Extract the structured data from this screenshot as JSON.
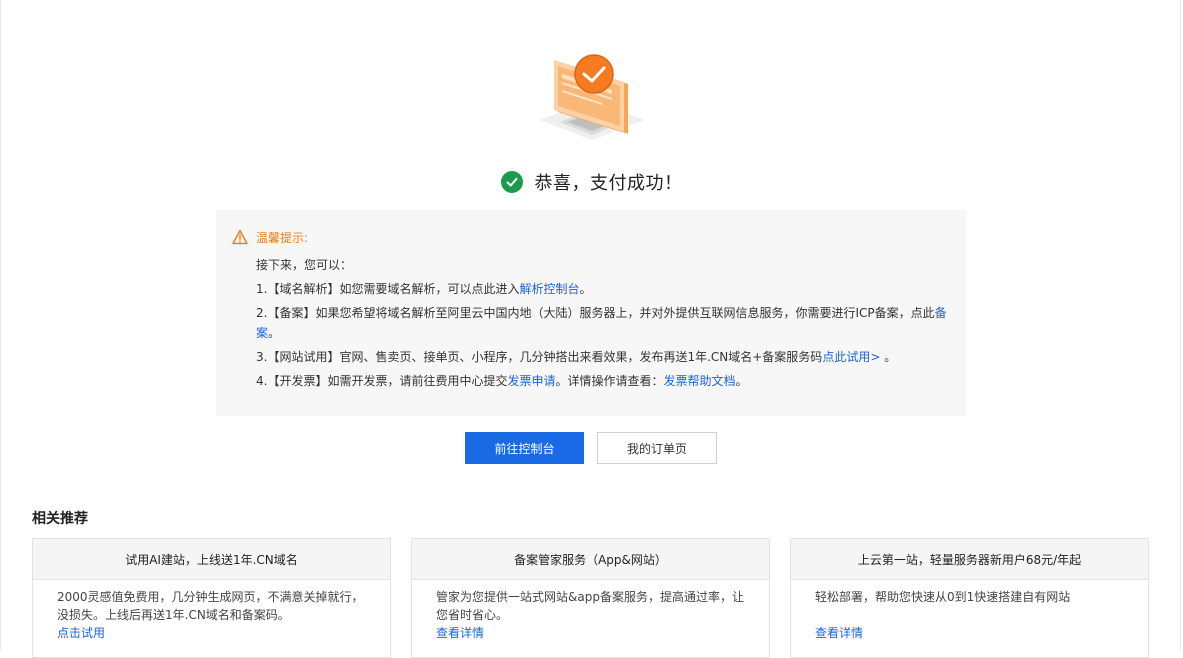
{
  "success": {
    "title": "恭喜，支付成功！"
  },
  "tips": {
    "heading": "温馨提示:",
    "intro": "接下来，您可以：",
    "item1": {
      "text": "1.【域名解析】如您需要域名解析，可以点此进入",
      "link": "解析控制台",
      "tail": "。"
    },
    "item2": {
      "text": "2.【备案】如果您希望将域名解析至阿里云中国内地（大陆）服务器上，并对外提供互联网信息服务，你需要进行ICP备案，点此",
      "link": "备案",
      "tail": "。"
    },
    "item3": {
      "text": "3.【网站试用】官网、售卖页、接单页、小程序，几分钟搭出来看效果，发布再送1年.CN域名+备案服务码",
      "link": "点此试用>",
      "tail": " 。"
    },
    "item4": {
      "text": "4.【开发票】如需开发票，请前往费用中心提交",
      "link": "发票申请",
      "mid": "。详情操作请查看：",
      "link2": "发票帮助文档",
      "tail": "。"
    }
  },
  "buttons": {
    "console": "前往控制台",
    "orders": "我的订单页"
  },
  "recommend": {
    "title": "相关推荐",
    "cards": [
      {
        "title": "试用AI建站，上线送1年.CN域名",
        "desc": "2000灵感值免费用，几分钟生成网页，不满意关掉就行，没损失。上线后再送1年.CN域名和备案码。",
        "link": "点击试用"
      },
      {
        "title": "备案管家服务（App&网站）",
        "desc": "管家为您提供一站式网站&app备案服务，提高通过率，让您省时省心。",
        "link": "查看详情"
      },
      {
        "title": "上云第一站，轻量服务器新用户68元/年起",
        "desc": "轻松部署，帮助您快速从0到1快速搭建自有网站",
        "link": "查看详情"
      }
    ]
  },
  "colors": {
    "primary": "#1a6ae6",
    "success": "#1e9a4e",
    "warning": "#ed7d1b",
    "link": "#1c64d6",
    "accent": "#f57b20"
  }
}
